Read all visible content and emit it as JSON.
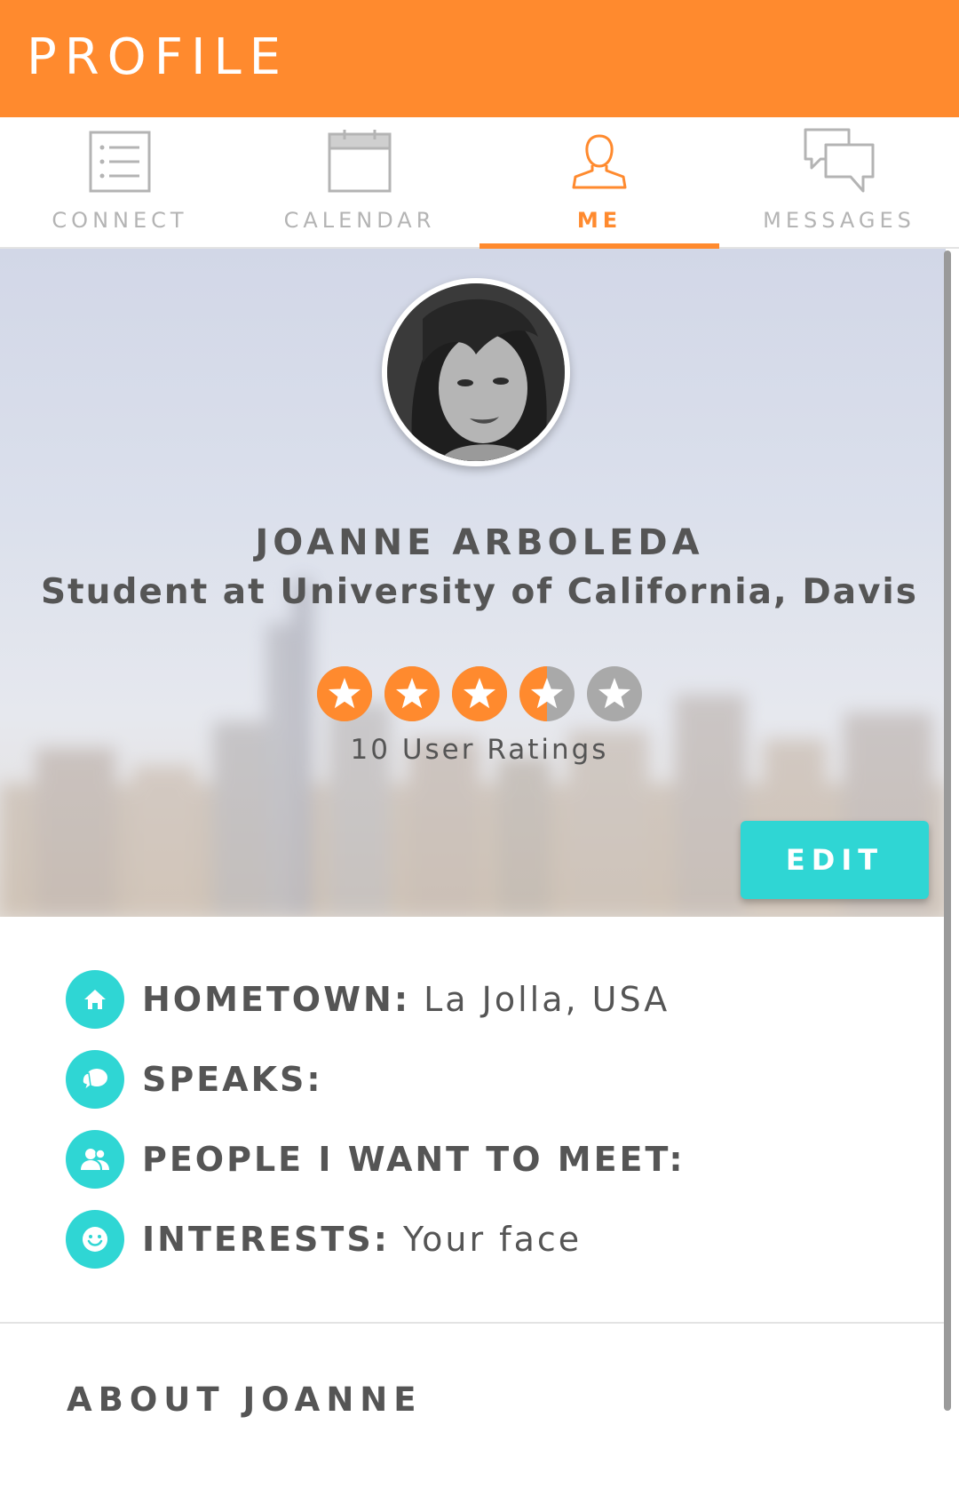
{
  "header": {
    "title": "PROFILE"
  },
  "tabs": [
    {
      "label": "CONNECT",
      "icon": "list-icon",
      "active": false
    },
    {
      "label": "CALENDAR",
      "icon": "calendar-icon",
      "active": false
    },
    {
      "label": "ME",
      "icon": "person-icon",
      "active": true
    },
    {
      "label": "MESSAGES",
      "icon": "chat-bubbles-icon",
      "active": false
    }
  ],
  "profile": {
    "name": "JOANNE ARBOLEDA",
    "subtitle": "Student at University of California, Davis",
    "rating": 3.5,
    "rating_max": 5,
    "ratings_text": "10 User Ratings",
    "edit_label": "EDIT"
  },
  "details": [
    {
      "key": "HOMETOWN:",
      "value": " La Jolla, USA",
      "icon": "home-icon"
    },
    {
      "key": "SPEAKS:",
      "value": "",
      "icon": "chat-icon"
    },
    {
      "key": "PEOPLE I WANT TO MEET:",
      "value": "",
      "icon": "people-icon"
    },
    {
      "key": "INTERESTS:",
      "value": " Your face",
      "icon": "smiley-icon"
    }
  ],
  "about": {
    "title": "ABOUT JOANNE"
  },
  "colors": {
    "accent": "#ff8a2e",
    "teal": "#2fd6d4",
    "inactive": "#b4b4b4",
    "star_empty": "#a9a9a9"
  }
}
